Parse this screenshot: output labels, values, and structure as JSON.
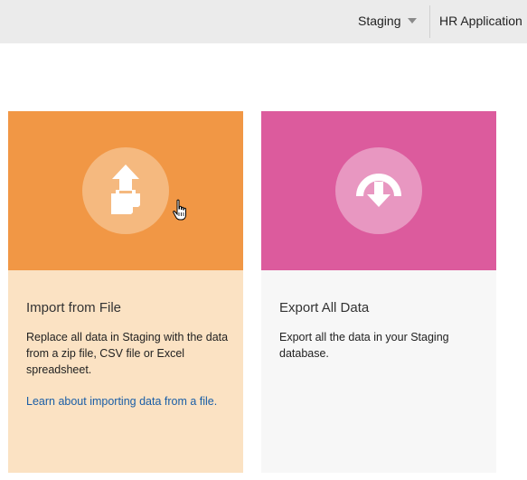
{
  "header": {
    "environment": "Staging",
    "app_name": "HR Application"
  },
  "cards": [
    {
      "title": "Import from File",
      "description": "Replace all data in Staging with the data from a zip file, CSV file or Excel spreadsheet.",
      "link": "Learn about importing data from a file.",
      "icon": "upload-file-icon",
      "top_color": "#f19745",
      "circle_color": "#f5b97f",
      "bottom_color": "#fbe2c3"
    },
    {
      "title": "Export All Data",
      "description": "Export all the data in your Staging database.",
      "icon": "download-icon",
      "top_color": "#dc5b9d",
      "circle_color": "#e897c1",
      "bottom_color": "#f7f7f7"
    }
  ]
}
